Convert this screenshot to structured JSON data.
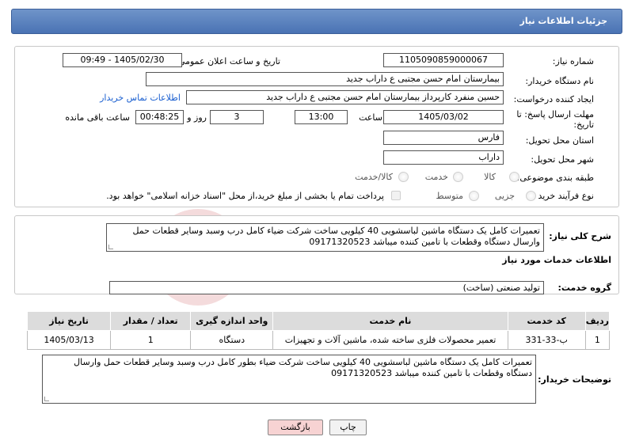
{
  "header": {
    "title": "جزئیات اطلاعات نیاز"
  },
  "form": {
    "need_number_label": "شماره نیاز:",
    "need_number": "1105090859000067",
    "announce_label": "تاریخ و ساعت اعلان عمومی:",
    "announce_value": "1405/02/30 - 09:49",
    "buyer_org_label": "نام دستگاه خریدار:",
    "buyer_org": "بیمارستان امام حسن مجتبی  ع  داراب جدید",
    "creator_label": "ایجاد کننده درخواست:",
    "creator": "حسین  منفرد کارپرداز بیمارستان امام حسن مجتبی  ع  داراب جدید",
    "contact_link": "اطلاعات تماس خریدار",
    "deadline_label_1": "مهلت ارسال پاسخ: تا",
    "deadline_label_2": "تاریخ:",
    "deadline_date": "1405/03/02",
    "time_label": "ساعت",
    "deadline_time": "13:00",
    "days_value": "3",
    "days_label": "روز و",
    "remaining_time": "00:48:25",
    "remaining_label": "ساعت باقی مانده",
    "province_label": "استان محل تحویل:",
    "province": "فارس",
    "city_label": "شهر محل تحویل:",
    "city": "داراب",
    "category_label": "طبقه بندی موضوعی:",
    "category_options": [
      "کالا",
      "خدمت",
      "کالا/خدمت"
    ],
    "process_label": "نوع فرآیند خرید :",
    "process_options": [
      "جزیی",
      "متوسط"
    ],
    "payment_note": "پرداخت تمام یا بخشی از مبلغ خرید،از محل \"اسناد خزانه اسلامی\" خواهد بود."
  },
  "summary": {
    "label": "شرح کلی نیاز:",
    "text": "تعمیرات کامل یک دستگاه ماشین لباسشویی 40 کیلویی ساخت شرکت ضیاء کامل درب وسبد وسایر قطعات حمل وارسال دستگاه وقطعات با تامین کننده میباشد 09171320523"
  },
  "services": {
    "title": "اطلاعات خدمات مورد نیاز",
    "group_label": "گروه خدمت:",
    "group_value": "تولید صنعتی (ساخت)",
    "columns": [
      "ردیف",
      "کد خدمت",
      "نام خدمت",
      "واحد اندازه گیری",
      "تعداد / مقدار",
      "تاریخ نیاز"
    ],
    "rows": [
      [
        "1",
        "ب-33-331",
        "تعمیر محصولات فلزی ساخته شده، ماشین آلات و تجهیزات",
        "دستگاه",
        "1",
        "1405/03/13"
      ]
    ]
  },
  "buyer_notes": {
    "label": "توضیحات خریدار:",
    "text": "تعمیرات کامل یک دستگاه ماشین لباسشویی 40 کیلویی ساخت شرکت ضیاء بطور کامل درب وسبد وسایر قطعات حمل وارسال دستگاه وقطعات با تامین کننده میباشد 09171320523"
  },
  "buttons": {
    "print": "چاپ",
    "back": "بازگشت"
  },
  "colors": {
    "header": "#4a73b4",
    "back_button": "#f7d3d3",
    "link": "#1a5fd0"
  }
}
